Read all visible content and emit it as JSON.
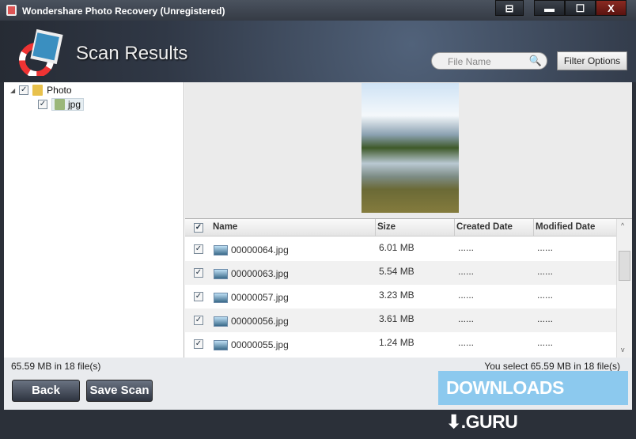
{
  "window": {
    "title": "Wondershare Photo Recovery (Unregistered)",
    "buttons": {
      "register": "⊟",
      "minimize": "▬",
      "maximize": "☐",
      "close": "X"
    }
  },
  "header": {
    "title": "Scan Results",
    "search_placeholder": "File Name",
    "filter_label": "Filter Options"
  },
  "tree": [
    {
      "label": "Photo",
      "checked": true
    },
    {
      "label": "jpg",
      "checked": true
    }
  ],
  "table": {
    "columns": [
      "Name",
      "Size",
      "Created Date",
      "Modified Date"
    ],
    "rows": [
      {
        "name": "00000064.jpg",
        "size": "6.01 MB",
        "created": "......",
        "modified": "......"
      },
      {
        "name": "00000063.jpg",
        "size": "5.54 MB",
        "created": "......",
        "modified": "......"
      },
      {
        "name": "00000057.jpg",
        "size": "3.23 MB",
        "created": "......",
        "modified": "......"
      },
      {
        "name": "00000056.jpg",
        "size": "3.61 MB",
        "created": "......",
        "modified": "......"
      },
      {
        "name": "00000055.jpg",
        "size": "1.24 MB",
        "created": "......",
        "modified": "......"
      }
    ]
  },
  "footer": {
    "total": "65.59 MB in 18 file(s)",
    "selected": "You select 65.59 MB in 18 file(s)",
    "back": "Back",
    "save_scan": "Save Scan"
  },
  "watermark": "DOWNLOADS ⬇.GURU"
}
